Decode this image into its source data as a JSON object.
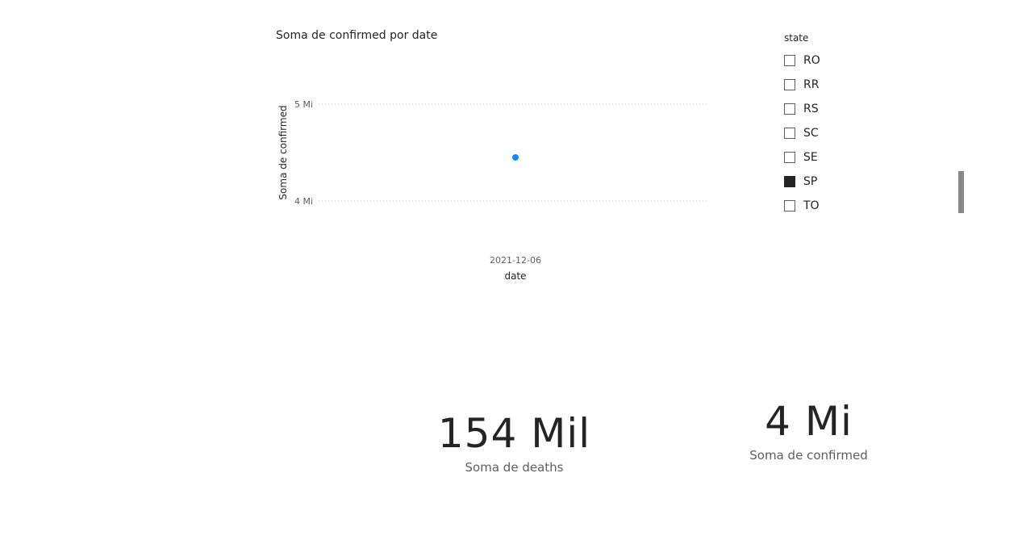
{
  "chart": {
    "title": "Soma de confirmed por date",
    "ylabel": "Soma de confirmed",
    "xlabel": "date",
    "x_tick": "2021-12-06",
    "y_ticks": [
      "5 Mi",
      "4 Mi"
    ]
  },
  "chart_data": {
    "type": "scatter",
    "title": "Soma de confirmed por date",
    "xlabel": "date",
    "ylabel": "Soma de confirmed",
    "x": [
      "2021-12-06"
    ],
    "series": [
      {
        "values": [
          4450000
        ]
      }
    ],
    "ylim": [
      4000000,
      5000000
    ],
    "y_tick_labels": [
      "4 Mi",
      "5 Mi"
    ],
    "grid": true,
    "color": "#118DFF"
  },
  "slicer": {
    "header": "state",
    "items": [
      {
        "label": "RO",
        "checked": false
      },
      {
        "label": "RR",
        "checked": false
      },
      {
        "label": "RS",
        "checked": false
      },
      {
        "label": "SC",
        "checked": false
      },
      {
        "label": "SE",
        "checked": false
      },
      {
        "label": "SP",
        "checked": true
      },
      {
        "label": "TO",
        "checked": false
      }
    ]
  },
  "cards": {
    "deaths": {
      "value": "154 Mil",
      "label": "Soma de deaths"
    },
    "confirmed": {
      "value": "4 Mi",
      "label": "Soma de confirmed"
    }
  }
}
